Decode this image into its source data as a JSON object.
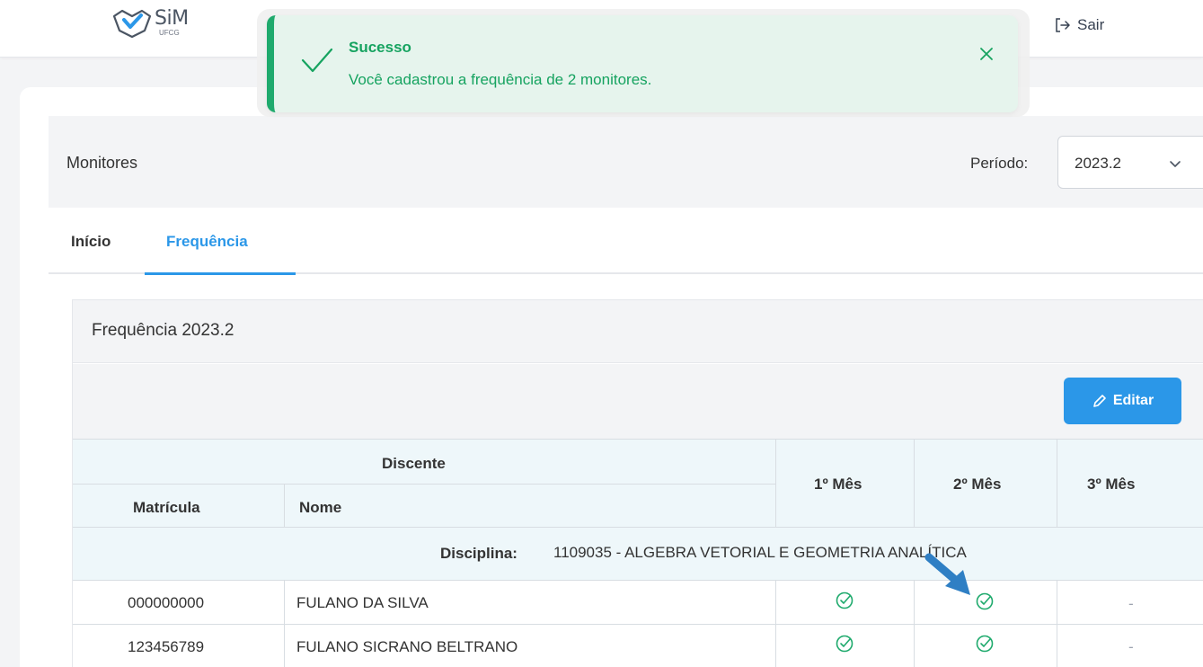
{
  "app": {
    "logo_text": "SiM",
    "logo_sub": "UFCG",
    "logout_label": "Sair",
    "brand_color": "#2b97e8"
  },
  "toast": {
    "title": "Sucesso",
    "message": "Você cadastrou a frequência de 2 monitores.",
    "color": "#16a360"
  },
  "header": {
    "title": "Monitores",
    "period_label": "Período:",
    "period_value": "2023.2"
  },
  "tabs": [
    {
      "label": "Início",
      "active": false
    },
    {
      "label": "Frequência",
      "active": true
    }
  ],
  "section": {
    "title": "Frequência 2023.2",
    "edit_label": "Editar"
  },
  "table": {
    "group_header": "Discente",
    "columns": [
      "Matrícula",
      "Nome",
      "1º Mês",
      "2º Mês",
      "3º Mês"
    ],
    "discipline_label": "Disciplina:",
    "discipline_value": "1109035 - ALGEBRA VETORIAL E GEOMETRIA ANALÍTICA",
    "rows": [
      {
        "matricula": "000000000",
        "nome": "FULANO DA SILVA",
        "mes1": "check",
        "mes2": "check",
        "mes3": "-"
      },
      {
        "matricula": "123456789",
        "nome": "FULANO SICRANO BELTRANO",
        "mes1": "check",
        "mes2": "check",
        "mes3": "-"
      }
    ]
  },
  "icons": {
    "check": "check-circle-icon",
    "edit": "pencil-icon",
    "logout": "logout-icon",
    "close": "close-icon",
    "chevron": "chevron-down-icon"
  }
}
